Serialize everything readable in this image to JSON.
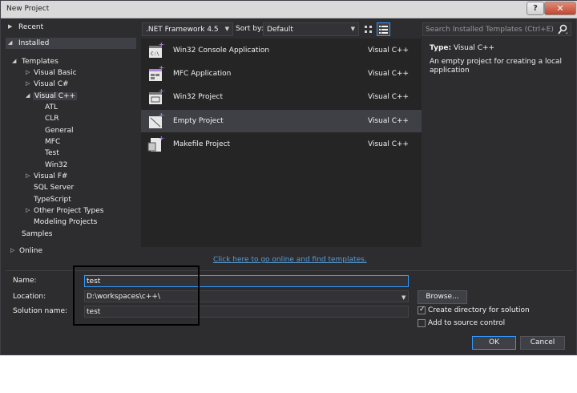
{
  "window": {
    "title": "New Project",
    "help_glyph": "?",
    "close_glyph": "✕"
  },
  "tree": {
    "recent": "Recent",
    "installed": "Installed",
    "templates": "Templates",
    "visual_basic": "Visual Basic",
    "visual_csharp": "Visual C#",
    "visual_cpp": "Visual C++",
    "cpp_children": [
      "ATL",
      "CLR",
      "General",
      "MFC",
      "Test",
      "Win32"
    ],
    "visual_fsharp": "Visual F#",
    "sql_server": "SQL Server",
    "typescript": "TypeScript",
    "other_project_types": "Other Project Types",
    "modeling_projects": "Modeling Projects",
    "samples": "Samples",
    "online": "Online"
  },
  "toolbar": {
    "framework": ".NET Framework 4.5",
    "sort_by_label": "Sort by:",
    "sort_by_value": "Default"
  },
  "search": {
    "placeholder": "Search Installed Templates (Ctrl+E)"
  },
  "templates": [
    {
      "name": "Win32 Console Application",
      "lang": "Visual C++",
      "icon": "console-app-icon"
    },
    {
      "name": "MFC Application",
      "lang": "Visual C++",
      "icon": "mfc-app-icon"
    },
    {
      "name": "Win32 Project",
      "lang": "Visual C++",
      "icon": "win32-project-icon"
    },
    {
      "name": "Empty Project",
      "lang": "Visual C++",
      "icon": "empty-project-icon"
    },
    {
      "name": "Makefile Project",
      "lang": "Visual C++",
      "icon": "makefile-project-icon"
    }
  ],
  "online_link": "Click here to go online and find templates.",
  "description": {
    "type_label": "Type:",
    "type_value": "Visual C++",
    "text": "An empty project for creating a local application"
  },
  "form": {
    "name_label": "Name:",
    "name_value": "test",
    "location_label": "Location:",
    "location_value": "D:\\workspaces\\c++\\",
    "solution_label": "Solution name:",
    "solution_value": "test",
    "browse": "Browse...",
    "create_dir": "Create directory for solution",
    "create_dir_checked": true,
    "add_source_control": "Add to source control",
    "add_source_control_checked": false,
    "ok": "OK",
    "cancel": "Cancel"
  },
  "colors": {
    "background": "#2d2d30",
    "list_background": "#252526",
    "selection": "#3f3f46",
    "accent": "#3399ff",
    "link": "#569cd6",
    "annotation": "#000000"
  }
}
